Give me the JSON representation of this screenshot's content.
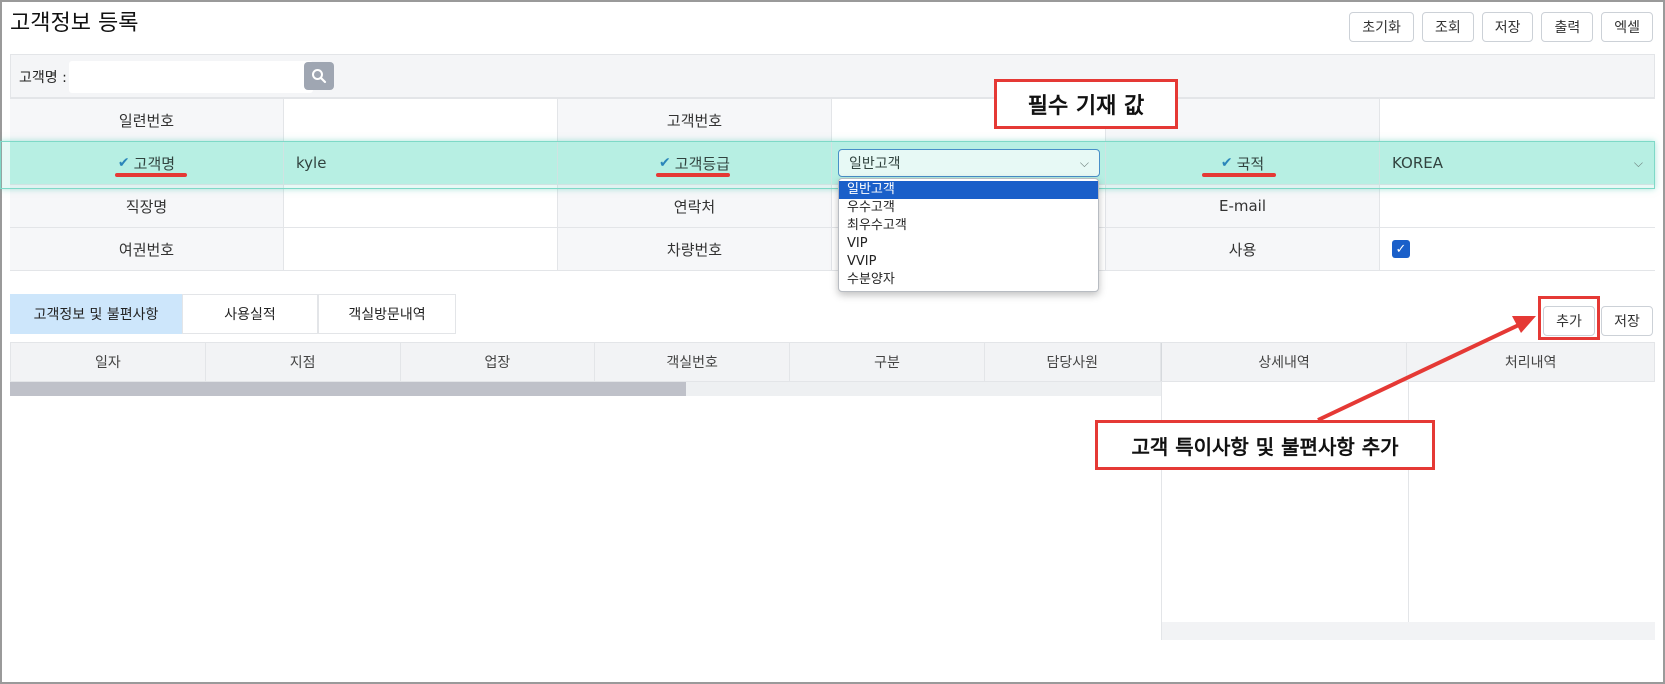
{
  "page": {
    "title": "고객정보 등록"
  },
  "toolbar": {
    "reset": "초기화",
    "search": "조회",
    "save": "저장",
    "print": "출력",
    "excel": "엑셀"
  },
  "search": {
    "label": "고객명 :",
    "value": "",
    "icon": "search-icon"
  },
  "form": {
    "row1": {
      "serial_label": "일련번호",
      "serial_value": "",
      "custno_label": "고객번호",
      "custno_value": ""
    },
    "row2": {
      "name_label": "고객명",
      "name_value": "kyle",
      "grade_label": "고객등급",
      "grade_value": "일반고객",
      "nation_label": "국적",
      "nation_value": "KOREA"
    },
    "row3": {
      "company_label": "직장명",
      "contact_label": "연락처",
      "email_label": "E-mail"
    },
    "row4": {
      "passport_label": "여권번호",
      "car_label": "차량번호",
      "use_label": "사용",
      "use_checked": true
    }
  },
  "grade_options": [
    "일반고객",
    "우수고객",
    "최우수고객",
    "VIP",
    "VVIP",
    "수분양자"
  ],
  "annotations": {
    "required": "필수 기재 값",
    "add_note": "고객 특이사항 및 불편사항 추가"
  },
  "tabs": [
    "고객정보 및 불편사항",
    "사용실적",
    "객실방문내역"
  ],
  "detail_buttons": {
    "add": "추가",
    "save": "저장"
  },
  "grid": {
    "columns": [
      "일자",
      "지점",
      "업장",
      "객실번호",
      "구분",
      "담당사원"
    ],
    "right_columns": [
      "상세내역",
      "처리내역"
    ]
  },
  "colors": {
    "accent": "#1a5fc9",
    "highlight": "#c5f3ea",
    "annotation": "#e53935",
    "active_tab": "#cde6fb"
  }
}
